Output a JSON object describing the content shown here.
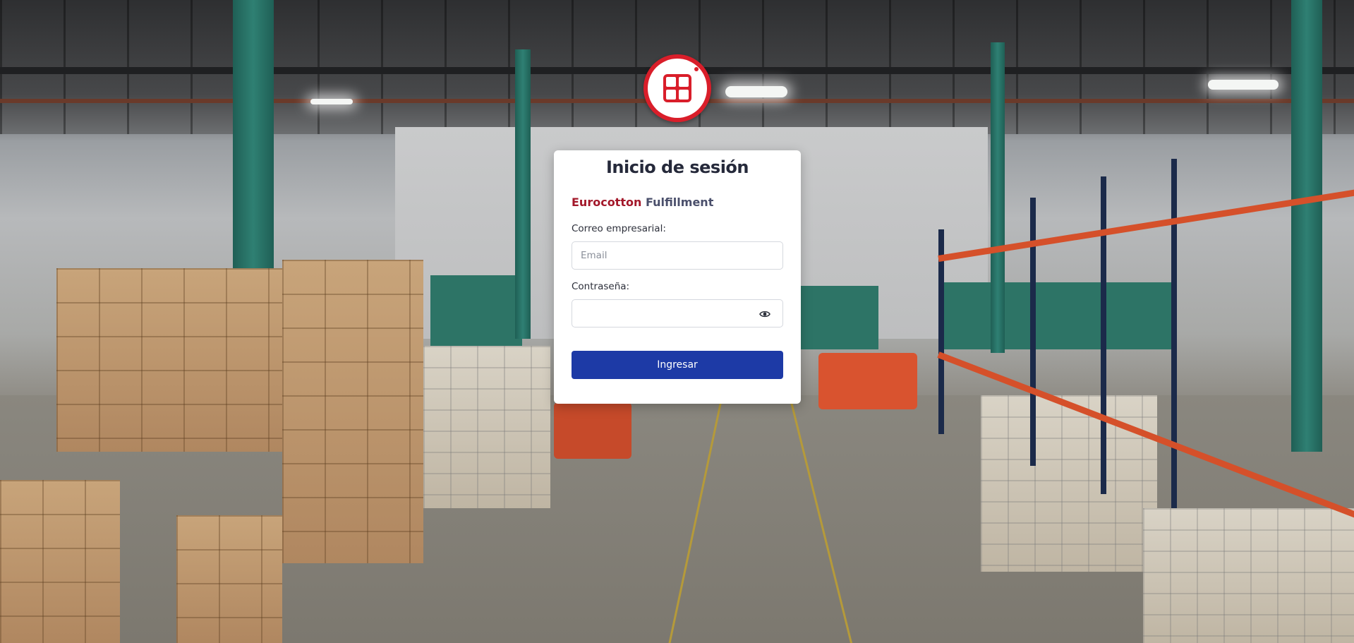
{
  "login": {
    "title": "Inicio de sesión",
    "brand_part1": "Eurocotton",
    "brand_part2": "Fulfillment",
    "email_label": "Correo empresarial:",
    "email_placeholder": "Email",
    "email_value": "",
    "password_label": "Contraseña:",
    "password_value": "",
    "submit_label": "Ingresar"
  },
  "icons": {
    "logo": "eurocotton-logo-icon",
    "show_password": "eye-icon"
  },
  "colors": {
    "logo_red": "#d91e2a",
    "brand_red": "#a3182a",
    "brand_gray": "#4a4f6b",
    "title": "#25293a",
    "button_blue": "#1d3aa6",
    "card_bg": "#ffffff"
  }
}
